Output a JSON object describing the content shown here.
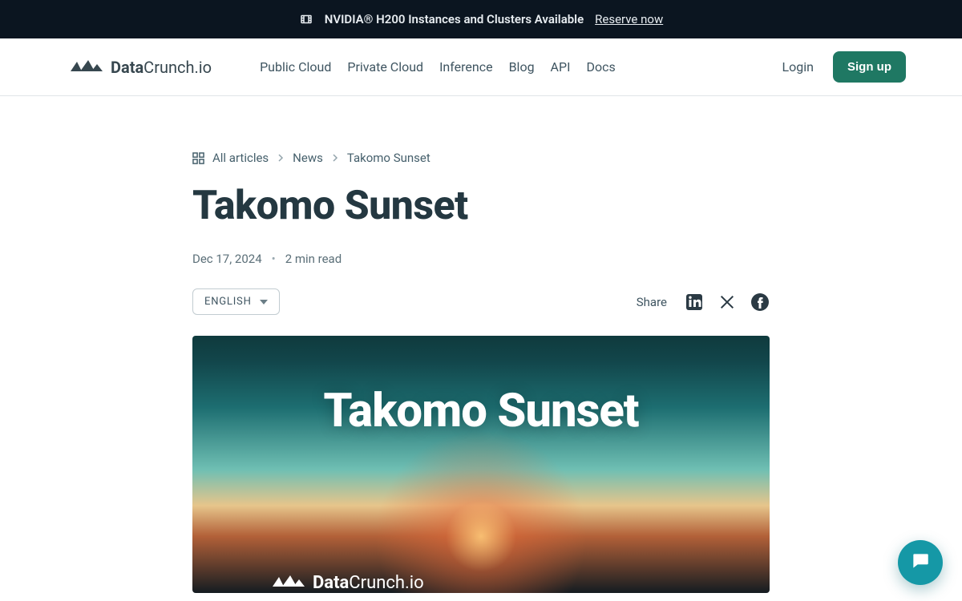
{
  "announcement": {
    "text": "NVIDIA® H200 Instances and Clusters Available",
    "cta": "Reserve now"
  },
  "brand": {
    "bold": "Data",
    "rest": "Crunch.io"
  },
  "nav": {
    "items": [
      "Public Cloud",
      "Private Cloud",
      "Inference",
      "Blog",
      "API",
      "Docs"
    ]
  },
  "auth": {
    "login": "Login",
    "signup": "Sign up"
  },
  "breadcrumb": {
    "root": "All articles",
    "section": "News",
    "current": "Takomo Sunset"
  },
  "article": {
    "title": "Takomo Sunset",
    "date": "Dec 17, 2024",
    "read_time": "2 min read"
  },
  "language": {
    "selected": "ENGLISH"
  },
  "share": {
    "label": "Share"
  },
  "hero": {
    "title": "Takomo Sunset",
    "brand_bold": "Data",
    "brand_rest": "Crunch.io"
  },
  "colors": {
    "signup_bg": "#1f7863",
    "chat_bg": "#1598a6",
    "announce_bg": "#0b1520"
  }
}
